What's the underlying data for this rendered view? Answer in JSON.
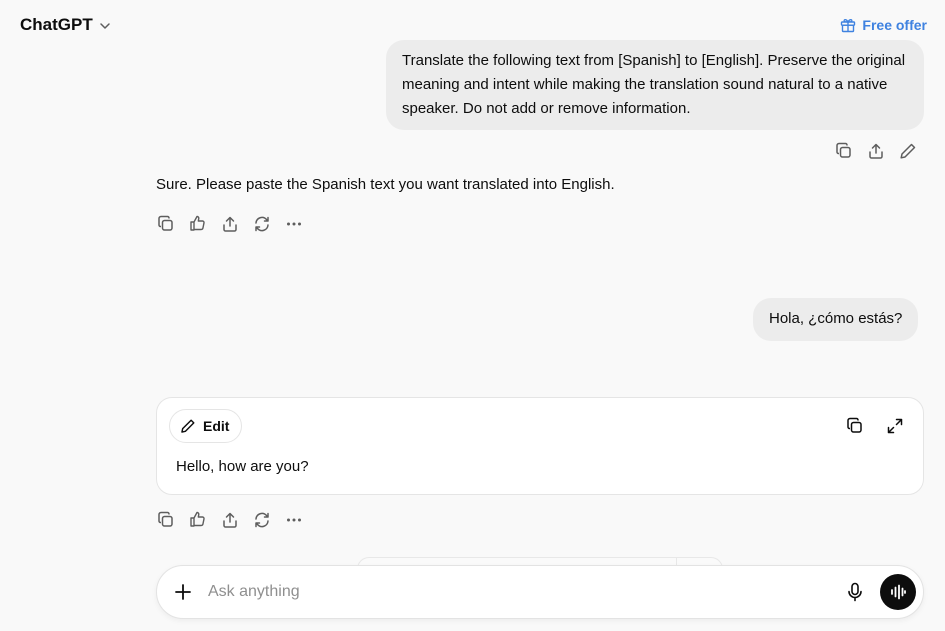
{
  "header": {
    "title": "ChatGPT",
    "title_icon": "chevron-down-icon",
    "offer_label": "Free offer",
    "offer_icon": "gift-icon",
    "offer_color": "#3f82e0"
  },
  "conversation": {
    "user_message_1": "Translate the following text from [Spanish] to [English]. Preserve the original meaning and intent while making the translation sound natural to a native speaker. Do not add or remove information.",
    "user_message_1_actions": [
      "copy-icon",
      "share-icon",
      "pencil-icon"
    ],
    "assistant_message_1": "Sure. Please paste the Spanish text you want translated into English.",
    "assistant_message_1_actions": [
      "copy-icon",
      "feedback-icon",
      "share-icon",
      "regenerate-icon",
      "more-icon"
    ],
    "user_message_2": "Hola, ¿cómo estás?",
    "canvas": {
      "edit_label": "Edit",
      "text": "Hello, how are you?",
      "icons": [
        "copy-icon",
        "expand-icon"
      ]
    },
    "assistant_message_2_actions": [
      "copy-icon",
      "feedback-icon",
      "share-icon",
      "regenerate-icon",
      "more-icon"
    ]
  },
  "composer": {
    "placeholder": "Ask anything",
    "icons": [
      "plus-icon",
      "microphone-icon",
      "voice-mode-icon"
    ]
  }
}
